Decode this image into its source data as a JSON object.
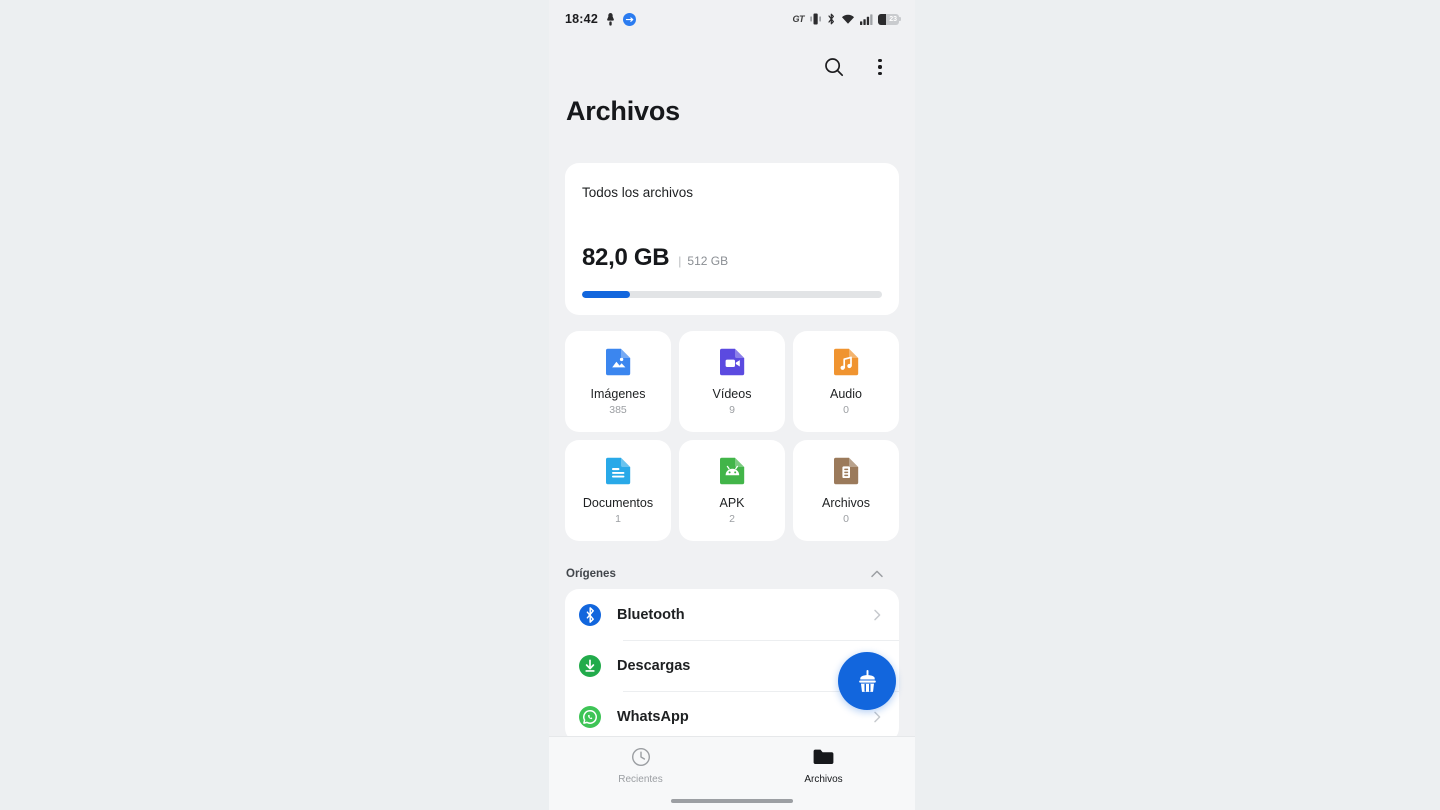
{
  "status_bar": {
    "time": "18:42",
    "left_icons": [
      "download-badge-icon",
      "blue-circle-badge-icon"
    ],
    "carrier_label": "GT",
    "right_icons": [
      "vibrate-icon",
      "bluetooth-icon",
      "wifi-icon",
      "signal-icon"
    ],
    "battery_percent": "23"
  },
  "toolbar": {
    "search_label": "search-icon",
    "overflow_label": "more-options-icon"
  },
  "header": {
    "title": "Archivos"
  },
  "storage": {
    "title": "Todos los archivos",
    "used": "82,0 GB",
    "separator": "|",
    "total": "512 GB",
    "percent_used": 16,
    "bar_color": "#1266dd"
  },
  "categories": [
    {
      "label": "Imágenes",
      "count": "385",
      "icon": "image-file-icon",
      "color": "#3b86ef"
    },
    {
      "label": "Vídeos",
      "count": "9",
      "icon": "video-file-icon",
      "color": "#5b4ae0"
    },
    {
      "label": "Audio",
      "count": "0",
      "icon": "audio-file-icon",
      "color": "#f09430"
    },
    {
      "label": "Documentos",
      "count": "1",
      "icon": "document-file-icon",
      "color": "#29a9e8"
    },
    {
      "label": "APK",
      "count": "2",
      "icon": "android-apk-icon",
      "color": "#42b549"
    },
    {
      "label": "Archivos",
      "count": "0",
      "icon": "archive-file-icon",
      "color": "#9b7a5b"
    }
  ],
  "origins": {
    "section_title": "Orígenes",
    "collapse_icon": "chevron-up-icon",
    "items": [
      {
        "label": "Bluetooth",
        "icon": "bluetooth-source-icon",
        "color": "#1266dd",
        "chevron": "chevron-right-icon"
      },
      {
        "label": "Descargas",
        "icon": "downloads-source-icon",
        "color": "#22ab4b",
        "chevron": "chevron-right-icon"
      },
      {
        "label": "WhatsApp",
        "icon": "whatsapp-source-icon",
        "color": "#3ec456",
        "chevron": "chevron-right-icon"
      }
    ]
  },
  "fab": {
    "icon": "broom-cleaner-icon",
    "color": "#1266dd"
  },
  "bottom_nav": {
    "items": [
      {
        "label": "Recientes",
        "icon": "clock-icon",
        "active": false
      },
      {
        "label": "Archivos",
        "icon": "folder-icon",
        "active": true
      }
    ]
  }
}
